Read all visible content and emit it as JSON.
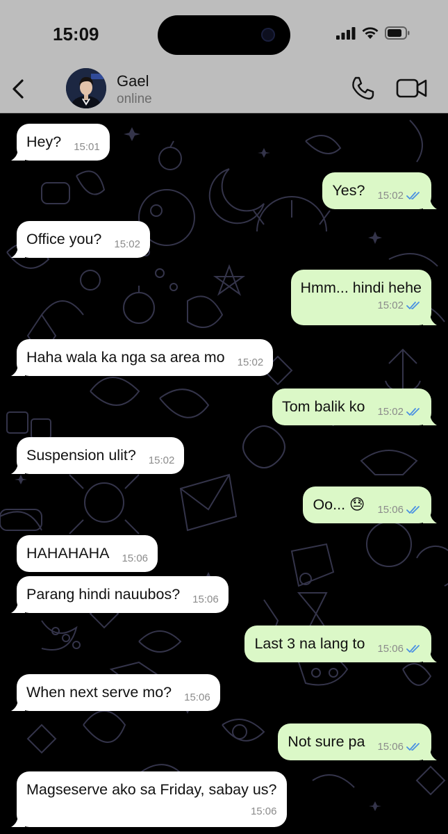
{
  "status": {
    "time": "15:09"
  },
  "contact": {
    "name": "Gael",
    "status": "online"
  },
  "messages": [
    {
      "dir": "in",
      "text": "Hey?",
      "time": "15:01"
    },
    {
      "dir": "out",
      "text": "Yes?",
      "time": "15:02",
      "read": true
    },
    {
      "dir": "in",
      "text": "Office you?",
      "time": "15:02"
    },
    {
      "dir": "out",
      "text": "Hmm... hindi hehe",
      "time": "15:02",
      "read": true
    },
    {
      "dir": "in",
      "text": "Haha wala ka nga sa area mo",
      "time": "15:02"
    },
    {
      "dir": "out",
      "text": "Tom balik ko",
      "time": "15:02",
      "read": true
    },
    {
      "dir": "in",
      "text": "Suspension ulit?",
      "time": "15:02"
    },
    {
      "dir": "out",
      "text": "Oo... 😓",
      "time": "15:06",
      "read": true
    },
    {
      "dir": "in",
      "text": "HAHAHAHA",
      "time": "15:06"
    },
    {
      "dir": "in",
      "text": "Parang hindi nauubos?",
      "time": "15:06"
    },
    {
      "dir": "out",
      "text": "Last 3 na lang to",
      "time": "15:06",
      "read": true
    },
    {
      "dir": "in",
      "text": "When next serve mo?",
      "time": "15:06"
    },
    {
      "dir": "out",
      "text": "Not sure pa",
      "time": "15:06",
      "read": true
    },
    {
      "dir": "in",
      "text": "Magseserve ako sa Friday, sabay us?",
      "time": "15:06"
    }
  ],
  "colors": {
    "header_bg": "#bdbdbd",
    "incoming_bubble": "#ffffff",
    "outgoing_bubble": "#dbf8c7",
    "read_ticks": "#4a90e2",
    "wallpaper_doodle": "#34344a"
  },
  "icons": {
    "back": "chevron-left-icon",
    "call": "phone-icon",
    "video": "video-camera-icon",
    "read_receipt": "double-check-icon"
  }
}
